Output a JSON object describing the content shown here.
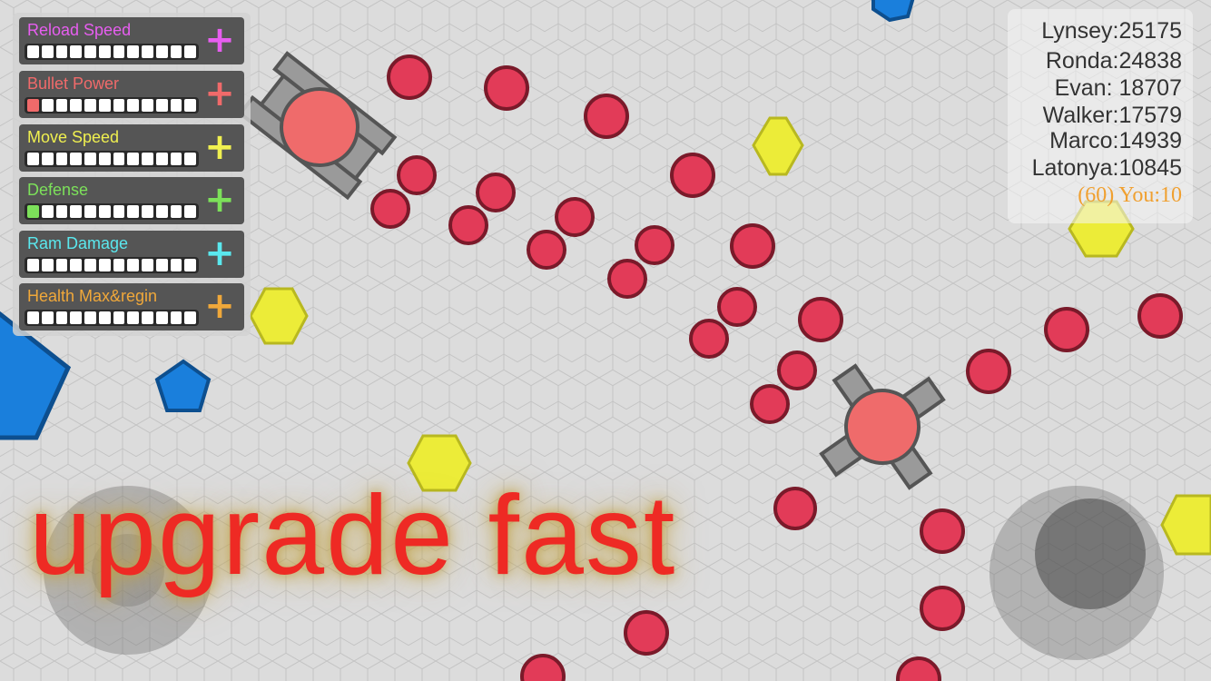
{
  "upgrades": [
    {
      "label": "Reload Speed",
      "color": "#e75ef0",
      "level": 0,
      "max": 12,
      "plus": "+"
    },
    {
      "label": "Bullet Power",
      "color": "#f06a6a",
      "level": 1,
      "max": 12,
      "plus": "+"
    },
    {
      "label": "Move Speed",
      "color": "#f0f050",
      "level": 0,
      "max": 12,
      "plus": "+"
    },
    {
      "label": "Defense",
      "color": "#7ce05a",
      "level": 1,
      "max": 12,
      "plus": "+"
    },
    {
      "label": "Ram Damage",
      "color": "#5ae8ee",
      "level": 0,
      "max": 12,
      "plus": "+"
    },
    {
      "label": "Health Max&regin",
      "color": "#f0a83a",
      "level": 0,
      "max": 12,
      "plus": "+"
    }
  ],
  "leaderboard": {
    "entries": [
      "Lynsey:25175",
      "Ronda:24838",
      "Evan: 18707",
      "Walker:17579",
      "Marco:14939",
      "Latonya:10845"
    ],
    "you": "(60) You:10"
  },
  "promo": {
    "text": "upgrade fast"
  },
  "colors": {
    "bullet": "#e23b58",
    "bullet_outline": "#7a1a2a",
    "tank_body": "#ef6b6b",
    "tank_barrel": "#9a9a9a",
    "square": "#ecec38",
    "pentagon": "#1a7fdc",
    "grid_line": "#bfbfbf"
  },
  "icons": {
    "upgrade": "plus-icon"
  }
}
